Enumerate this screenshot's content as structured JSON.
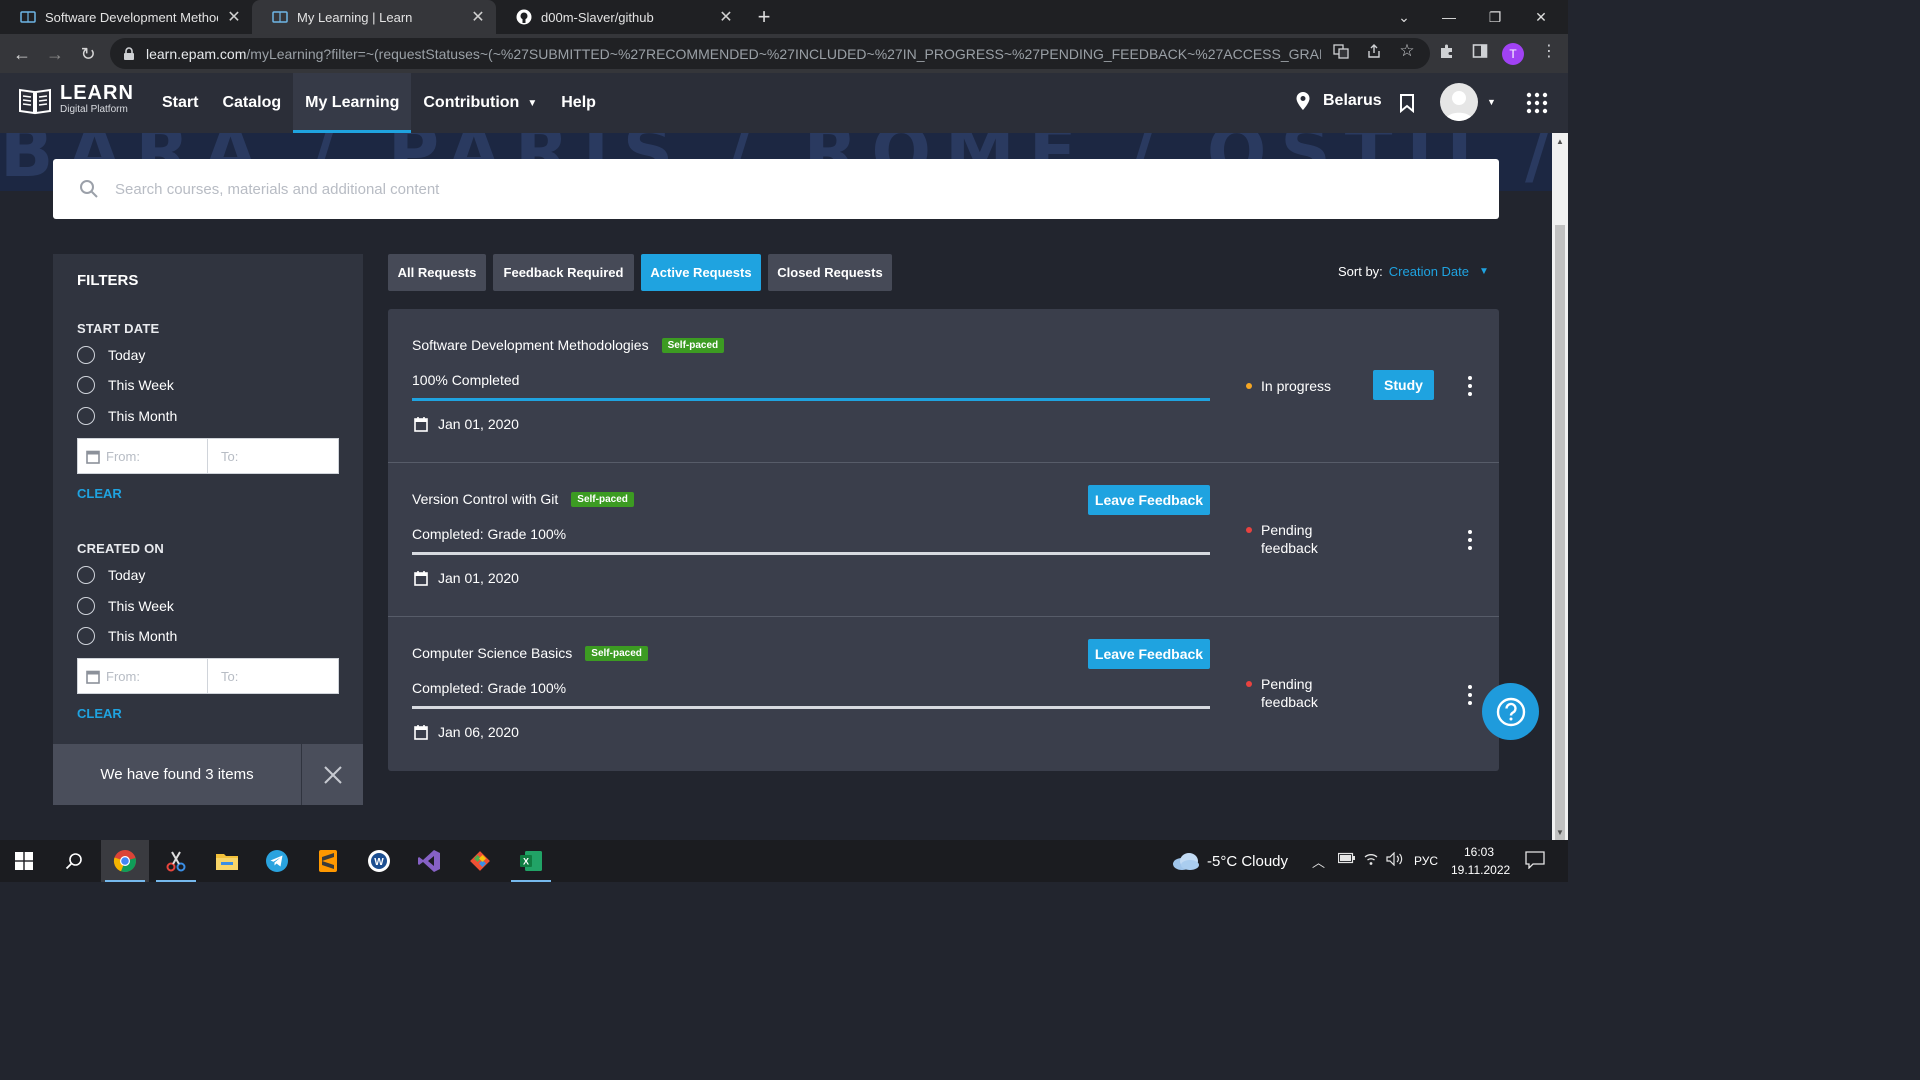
{
  "browser": {
    "tabs": [
      {
        "title": "Software Development Methodologies",
        "close": "✕"
      },
      {
        "title": "My Learning | Learn",
        "close": "✕"
      },
      {
        "title": "d00m-Slaver/github",
        "close": "✕"
      }
    ],
    "new_tab": "+",
    "url_host": "learn.epam.com",
    "url_path": "/myLearning?filter=~(requestStatuses~(~%27SUBMITTED~%27RECOMMENDED~%27INCLUDED~%27IN_PROGRESS~%27PENDING_FEEDBACK~%27ACCESS_GRANTED...",
    "profile_initial": "T"
  },
  "header": {
    "logo_title": "LEARN",
    "logo_subtitle": "Digital Platform",
    "nav": [
      {
        "label": "Start"
      },
      {
        "label": "Catalog"
      },
      {
        "label": "My Learning"
      },
      {
        "label": "Contribution"
      },
      {
        "label": "Help"
      }
    ],
    "location": "Belarus"
  },
  "banner_text": "BARA / PARIS / ROME / OSTIJ / FERRAR",
  "search": {
    "placeholder": "Search courses, materials and additional content"
  },
  "filters": {
    "title": "FILTERS",
    "start_date": {
      "title": "START DATE",
      "options": [
        "Today",
        "This Week",
        "This Month"
      ],
      "from_placeholder": "From:",
      "to_placeholder": "To:",
      "clear": "CLEAR"
    },
    "created_on": {
      "title": "CREATED ON",
      "options": [
        "Today",
        "This Week",
        "This Month"
      ],
      "from_placeholder": "From:",
      "to_placeholder": "To:",
      "clear": "CLEAR"
    },
    "found_text": "We have found 3 items"
  },
  "request_tabs": [
    "All Requests",
    "Feedback Required",
    "Active Requests",
    "Closed Requests"
  ],
  "active_tab": "Active Requests",
  "sort": {
    "label": "Sort by:",
    "value": "Creation Date"
  },
  "courses": [
    {
      "title": "Software Development Methodologies",
      "badge": "Self-paced",
      "progress_text": "100% Completed",
      "progress": 100,
      "date": "Jan 01, 2020",
      "status": "In progress",
      "status_color": "#f5a623",
      "action": "Study"
    },
    {
      "title": "Version Control with Git",
      "badge": "Self-paced",
      "progress_text": "Completed: Grade 100%",
      "progress": 0,
      "date": "Jan 01, 2020",
      "status": "Pending feedback",
      "status_color": "#e8423f",
      "action": "Leave Feedback"
    },
    {
      "title": "Computer Science Basics",
      "badge": "Self-paced",
      "progress_text": "Completed: Grade 100%",
      "progress": 0,
      "date": "Jan 06, 2020",
      "status": "Pending feedback",
      "status_color": "#e8423f",
      "action": "Leave Feedback"
    }
  ],
  "taskbar": {
    "weather": "-5°C  Cloudy",
    "language": "РУС",
    "time": "16:03",
    "date": "19.11.2022"
  },
  "colors": {
    "accent": "#1fa3e0",
    "badge": "#3c9b22"
  }
}
